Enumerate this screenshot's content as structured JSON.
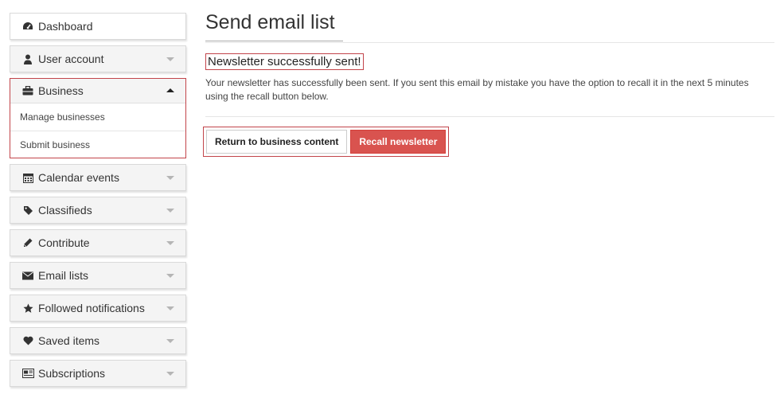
{
  "sidebar": {
    "items": [
      {
        "label": "Dashboard",
        "icon": "dashboard-icon"
      },
      {
        "label": "User account",
        "icon": "user-icon"
      },
      {
        "label": "Business",
        "icon": "briefcase-icon",
        "expanded": true,
        "children": [
          {
            "label": "Manage businesses"
          },
          {
            "label": "Submit business"
          }
        ]
      },
      {
        "label": "Calendar events",
        "icon": "calendar-icon"
      },
      {
        "label": "Classifieds",
        "icon": "tag-icon"
      },
      {
        "label": "Contribute",
        "icon": "pencil-icon"
      },
      {
        "label": "Email lists",
        "icon": "envelope-icon"
      },
      {
        "label": "Followed notifications",
        "icon": "star-icon"
      },
      {
        "label": "Saved items",
        "icon": "heart-icon"
      },
      {
        "label": "Subscriptions",
        "icon": "newspaper-icon"
      }
    ]
  },
  "main": {
    "title": "Send email list",
    "success_message": "Newsletter successfully sent!",
    "body_text": "Your newsletter has successfully been sent. If you sent this email by mistake you have the option to recall it in the next 5 minutes using the recall button below.",
    "buttons": {
      "return_label": "Return to business content",
      "recall_label": "Recall newsletter"
    }
  },
  "colors": {
    "highlight_border": "#c2444a",
    "danger_button": "#d9534f",
    "sidebar_bg": "#f4f4f4"
  }
}
